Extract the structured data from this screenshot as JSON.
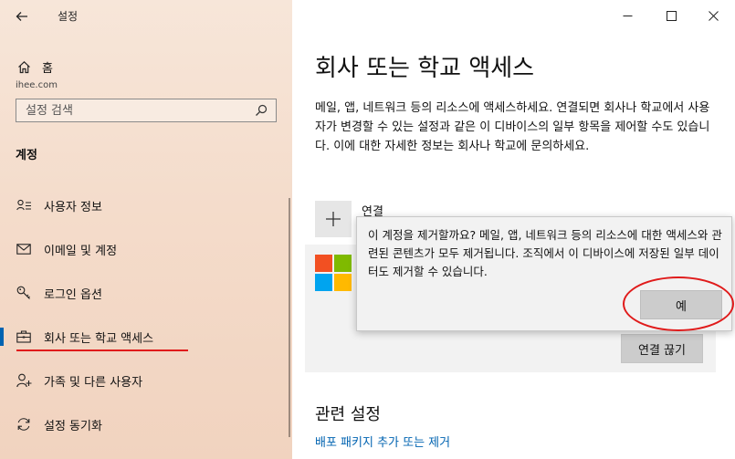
{
  "window": {
    "title": "설정"
  },
  "sidebar": {
    "home_label": "홈",
    "domain": "ihee.com",
    "search_placeholder": "설정 검색",
    "section_title": "계정",
    "items": [
      {
        "label": "사용자 정보",
        "icon": "person-card-icon"
      },
      {
        "label": "이메일 및 계정",
        "icon": "mail-icon"
      },
      {
        "label": "로그인 옵션",
        "icon": "key-icon"
      },
      {
        "label": "회사 또는 학교 액세스",
        "icon": "briefcase-icon",
        "active": true
      },
      {
        "label": "가족 및 다른 사용자",
        "icon": "add-person-icon"
      },
      {
        "label": "설정 동기화",
        "icon": "sync-icon"
      }
    ]
  },
  "main": {
    "title": "회사 또는 학교 액세스",
    "description": "메일, 앱, 네트워크 등의 리소스에 액세스하세요. 연결되면 회사나 학교에서 사용자가 변경할 수 있는 설정과 같은 이 디바이스의 일부 항목을 제어할 수도 있습니다. 이에 대한 자세한 정보는 회사나 학교에 문의하세요.",
    "connect_label": "연결",
    "disconnect_label": "연결 끊기",
    "related_title": "관련 설정",
    "related_link": "배포 패키지 추가 또는 제거"
  },
  "dialog": {
    "message": "이 계정을 제거할까요? 메일, 앱, 네트워크 등의 리소스에 대한 액세스와 관련된 콘텐츠가 모두 제거됩니다. 조직에서 이 디바이스에 저장된 일부 데이터도 제거할 수 있습니다.",
    "confirm_label": "예"
  },
  "colors": {
    "accent": "#0063b1",
    "annotation": "#e01b1b",
    "ms_red": "#f25022",
    "ms_green": "#7fba00",
    "ms_blue": "#00a4ef",
    "ms_yellow": "#ffb900"
  }
}
